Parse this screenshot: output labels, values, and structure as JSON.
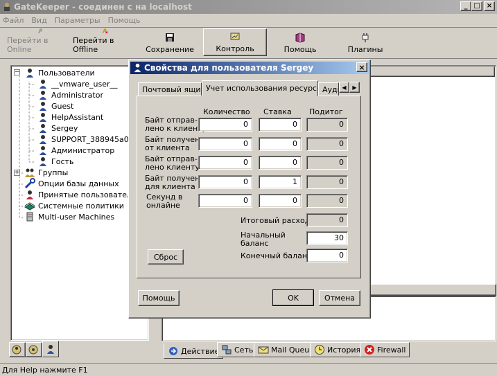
{
  "window": {
    "title": "GateKeeper - соединен с на localhost"
  },
  "menu": [
    "Файл",
    "Вид",
    "Параметры",
    "Помощь"
  ],
  "toolbar": {
    "go_online": "Перейти в Online",
    "go_offline": "Перейти в Offline",
    "save": "Сохранение",
    "control": "Контроль",
    "help": "Помощь",
    "plugins": "Плагины"
  },
  "tree": {
    "users": "Пользователи",
    "user_list": [
      "__vmware_user__",
      "Administrator",
      "Guest",
      "HelpAssistant",
      "Sergey",
      "SUPPORT_388945a0",
      "Администратор",
      "Гость"
    ],
    "groups": "Группы",
    "db_options": "Опции базы данных",
    "accepted_users": "Принятые пользователи",
    "system_policies": "Системные политики",
    "multiuser": "Multi-user Machines"
  },
  "dialog": {
    "title": "Свойства для пользователя Sergey",
    "tabs": [
      "Почтовый ящик",
      "Учет использования ресурсов",
      "Аудит"
    ],
    "columns": [
      "Количество",
      "Ставка",
      "Подитог"
    ],
    "rows": [
      {
        "label": "Байт отправ-\nлено к клиенту",
        "qty": "0",
        "rate": "0",
        "subtotal": "0"
      },
      {
        "label": "Байт получено\nот клиента",
        "qty": "0",
        "rate": "0",
        "subtotal": "0"
      },
      {
        "label": "Байт отправ-\nлено клиенту",
        "qty": "0",
        "rate": "0",
        "subtotal": "0"
      },
      {
        "label": "Байт получено\nдля клиента",
        "qty": "0",
        "rate": "1",
        "subtotal": "0"
      },
      {
        "label": "Секунд в\nонлайне",
        "qty": "0",
        "rate": "0",
        "subtotal": "0"
      }
    ],
    "total_label": "Итоговый расход",
    "total_value": "0",
    "start_balance_label": "Начальный\nбаланс",
    "start_balance_value": "30",
    "end_balance_label": "Конечный баланс",
    "end_balance_value": "0",
    "reset_button": "Сброс",
    "help_button": "Помощь",
    "ok_button": "OK",
    "cancel_button": "Отмена"
  },
  "bottom_tabs": [
    "Действие",
    "Сеть",
    "Mail Queue",
    "История",
    "Firewall"
  ],
  "status_bar": "Для Help нажмите F1"
}
